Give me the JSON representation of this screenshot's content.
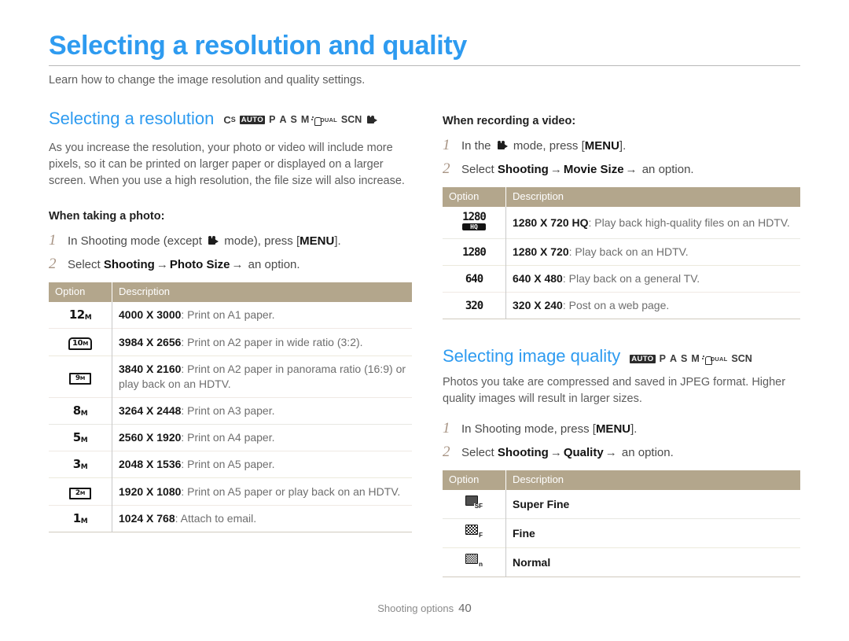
{
  "page": {
    "title": "Selecting a resolution and quality",
    "subtitle": "Learn how to change the image resolution and quality settings.",
    "accent_color": "#2e9bf0",
    "table_header_color": "#b3a68c",
    "step_number_color": "#a89484"
  },
  "footer": {
    "label": "Shooting options",
    "page_number": "40"
  },
  "resolution_section": {
    "title": "Selecting a resolution",
    "modes": [
      "Cs",
      "AUTO",
      "P",
      "A",
      "S",
      "M",
      "DUAL",
      "SCN",
      "video"
    ],
    "intro": "As you increase the resolution, your photo or video will include more pixels, so it can be printed on larger paper or displayed on a larger screen. When you use a high resolution, the file size will also increase.",
    "photo_heading": "When taking a photo:",
    "photo_steps": [
      {
        "num": "1",
        "prefix": "In Shooting mode (except ",
        "icon": "video-icon",
        "suffix": " mode), press [",
        "key": "MENU",
        "end": "]."
      },
      {
        "num": "2",
        "prefix": "Select ",
        "b1": "Shooting",
        "arrow1": "→",
        "b2": "Photo Size",
        "arrow2": "→",
        "end": " an option."
      }
    ],
    "photo_table": {
      "headers": [
        "Option",
        "Description"
      ],
      "rows": [
        {
          "icon": "12M",
          "icon_style": "plain",
          "value": "4000 X 3000",
          "desc": ": Print on A1 paper."
        },
        {
          "icon": "10M",
          "icon_style": "box",
          "value": "3984 X 2656",
          "desc": ": Print on A2 paper in wide ratio (3:2)."
        },
        {
          "icon": "9M",
          "icon_style": "wide",
          "value": "3840 X 2160",
          "desc": ": Print on A2 paper in panorama ratio (16:9) or play back on an HDTV."
        },
        {
          "icon": "8M",
          "icon_style": "plain",
          "value": "3264 X 2448",
          "desc": ": Print on A3 paper."
        },
        {
          "icon": "5M",
          "icon_style": "plain",
          "value": "2560 X 1920",
          "desc": ": Print on A4 paper."
        },
        {
          "icon": "3M",
          "icon_style": "plain",
          "value": "2048 X 1536",
          "desc": ": Print on A5 paper."
        },
        {
          "icon": "2M",
          "icon_style": "wide",
          "value": "1920 X 1080",
          "desc": ": Print on A5 paper or play back on an HDTV."
        },
        {
          "icon": "1M",
          "icon_style": "plain",
          "value": "1024 X 768",
          "desc": ": Attach to email."
        }
      ]
    },
    "video_heading": "When recording a video:",
    "video_steps": [
      {
        "num": "1",
        "prefix": "In the ",
        "icon": "video-icon",
        "suffix": " mode, press [",
        "key": "MENU",
        "end": "]."
      },
      {
        "num": "2",
        "prefix": "Select ",
        "b1": "Shooting",
        "arrow1": "→",
        "b2": "Movie Size",
        "arrow2": "→",
        "end": " an option."
      }
    ],
    "video_table": {
      "headers": [
        "Option",
        "Description"
      ],
      "rows": [
        {
          "icon": "1280",
          "badge": "HQ",
          "value": "1280 X 720 HQ",
          "desc": ": Play back high-quality files on an HDTV."
        },
        {
          "icon": "1280",
          "badge": "",
          "value": "1280 X 720",
          "desc": ": Play back on an HDTV."
        },
        {
          "icon": "640",
          "badge": "",
          "value": "640 X 480",
          "desc": ": Play back on a general TV."
        },
        {
          "icon": "320",
          "badge": "",
          "value": "320 X 240",
          "desc": ": Post on a web page."
        }
      ]
    }
  },
  "quality_section": {
    "title": "Selecting image quality",
    "modes": [
      "AUTO",
      "P",
      "A",
      "S",
      "M",
      "DUAL",
      "SCN"
    ],
    "intro": "Photos you take are compressed and saved in JPEG format. Higher quality images will result in larger sizes.",
    "steps": [
      {
        "num": "1",
        "prefix": "In Shooting mode, press [",
        "key": "MENU",
        "end": "]."
      },
      {
        "num": "2",
        "prefix": "Select ",
        "b1": "Shooting",
        "arrow1": "→",
        "b2": "Quality",
        "arrow2": "→",
        "end": " an option."
      }
    ],
    "table": {
      "headers": [
        "Option",
        "Description"
      ],
      "rows": [
        {
          "icon_tag": "SF",
          "icon_fill": "solid",
          "label": "Super Fine"
        },
        {
          "icon_tag": "F",
          "icon_fill": "check",
          "label": "Fine"
        },
        {
          "icon_tag": "n",
          "icon_fill": "check-lt",
          "label": "Normal"
        }
      ]
    }
  }
}
